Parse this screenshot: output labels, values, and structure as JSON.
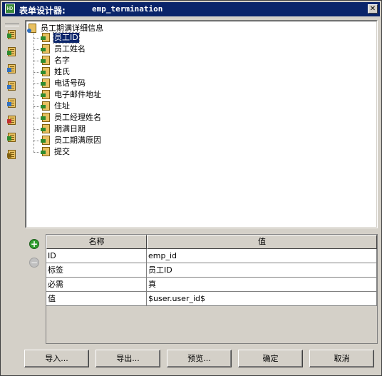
{
  "window": {
    "title": "表单设计器:",
    "form_name": "emp_termination",
    "app_icon_text": "HD",
    "close_glyph": "✕"
  },
  "toolbar": {
    "buttons": [
      {
        "icon": "form-list-icon"
      },
      {
        "icon": "add-field-icon"
      },
      {
        "icon": "field-search-icon"
      },
      {
        "icon": "field-export-icon"
      },
      {
        "icon": "field-grid-icon"
      },
      {
        "icon": "field-edit-icon"
      },
      {
        "icon": "field-check-icon"
      },
      {
        "icon": "field-settings-icon"
      }
    ]
  },
  "tree": {
    "root": {
      "label": "员工期满详细信息"
    },
    "items": [
      {
        "label": "员工ID",
        "selected": true
      },
      {
        "label": "员工姓名"
      },
      {
        "label": "名字"
      },
      {
        "label": "姓氏"
      },
      {
        "label": "电话号码"
      },
      {
        "label": "电子邮件地址"
      },
      {
        "label": "住址"
      },
      {
        "label": "员工经理姓名"
      },
      {
        "label": "期满日期"
      },
      {
        "label": "员工期满原因"
      },
      {
        "label": "提交"
      }
    ]
  },
  "properties": {
    "add_glyph": "+",
    "remove_glyph": "−",
    "headers": [
      "名称",
      "值"
    ],
    "rows": [
      [
        "ID",
        "emp_id"
      ],
      [
        "标签",
        "员工ID"
      ],
      [
        "必需",
        "真"
      ],
      [
        "值",
        "$user.user_id$"
      ]
    ]
  },
  "buttons": {
    "import": "导入...",
    "export": "导出...",
    "preview": "预览...",
    "ok": "确定",
    "cancel": "取消"
  },
  "colors": {
    "titlebar": "#0a246a",
    "selection": "#0a246a",
    "add_button": "#2f9e2f",
    "field_icon": "#e8c060"
  }
}
